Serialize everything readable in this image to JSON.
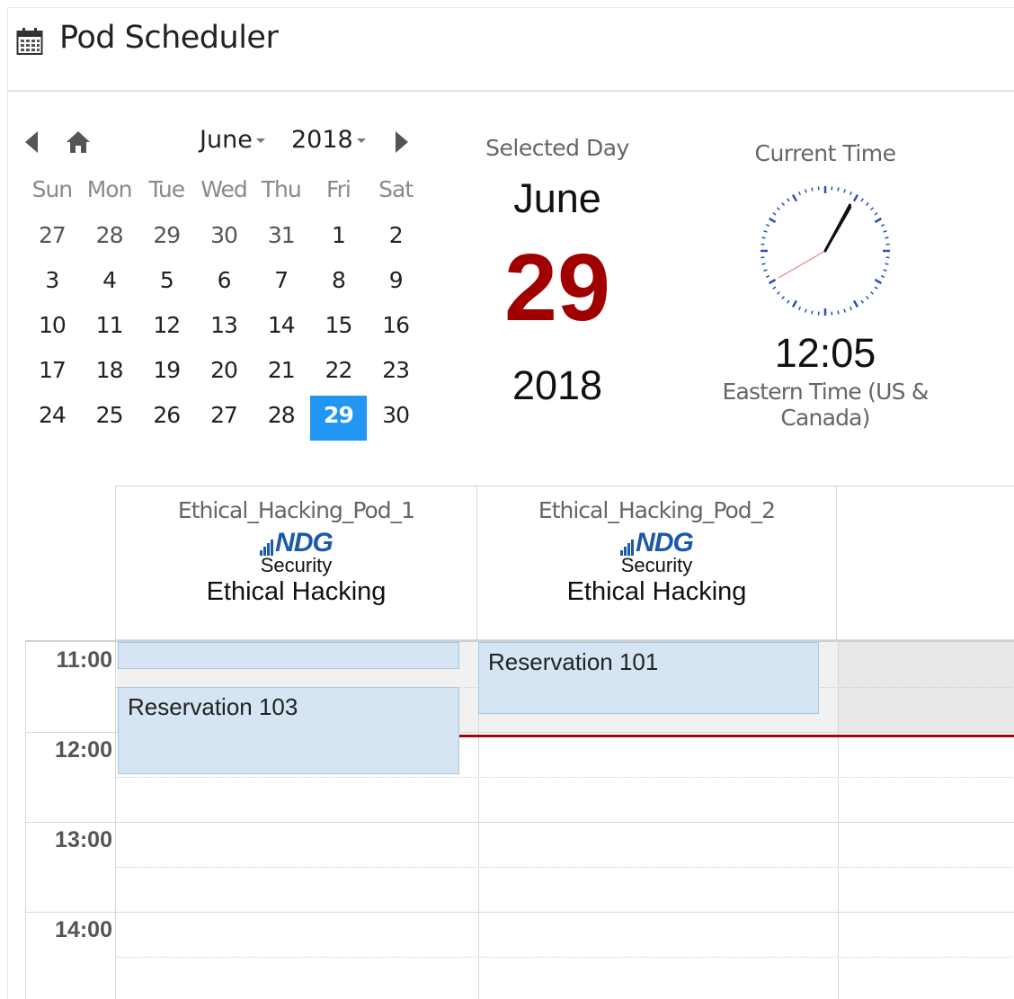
{
  "header": {
    "title": "Pod Scheduler",
    "icon": "calendar-icon"
  },
  "mini_calendar": {
    "month": "June",
    "year": "2018",
    "weekdays": [
      "Sun",
      "Mon",
      "Tue",
      "Wed",
      "Thu",
      "Fri",
      "Sat"
    ],
    "weeks": [
      [
        "27",
        "28",
        "29",
        "30",
        "31",
        "1",
        "2"
      ],
      [
        "3",
        "4",
        "5",
        "6",
        "7",
        "8",
        "9"
      ],
      [
        "10",
        "11",
        "12",
        "13",
        "14",
        "15",
        "16"
      ],
      [
        "17",
        "18",
        "19",
        "20",
        "21",
        "22",
        "23"
      ],
      [
        "24",
        "25",
        "26",
        "27",
        "28",
        "29",
        "30"
      ]
    ],
    "selected_day": "29",
    "accent_color": "#2196f3"
  },
  "selected_day": {
    "label": "Selected Day",
    "month": "June",
    "day": "29",
    "year": "2018",
    "day_color": "#a00000"
  },
  "current_time": {
    "label": "Current Time",
    "time": "12:05",
    "zone": "Eastern Time (US & Canada)"
  },
  "pods": [
    {
      "name": "Ethical_Hacking_Pod_1",
      "logo": "NDG",
      "logo_sub": "Security",
      "course": "Ethical Hacking"
    },
    {
      "name": "Ethical_Hacking_Pod_2",
      "logo": "NDG",
      "logo_sub": "Security",
      "course": "Ethical Hacking"
    }
  ],
  "schedule": {
    "hours": [
      "11:00",
      "12:00",
      "13:00",
      "14:00"
    ],
    "reservations": [
      {
        "label": "",
        "pod": 1
      },
      {
        "label": "Reservation 103",
        "pod": 1
      },
      {
        "label": "Reservation 101",
        "pod": 2
      }
    ],
    "now_line_color": "#b00000"
  }
}
